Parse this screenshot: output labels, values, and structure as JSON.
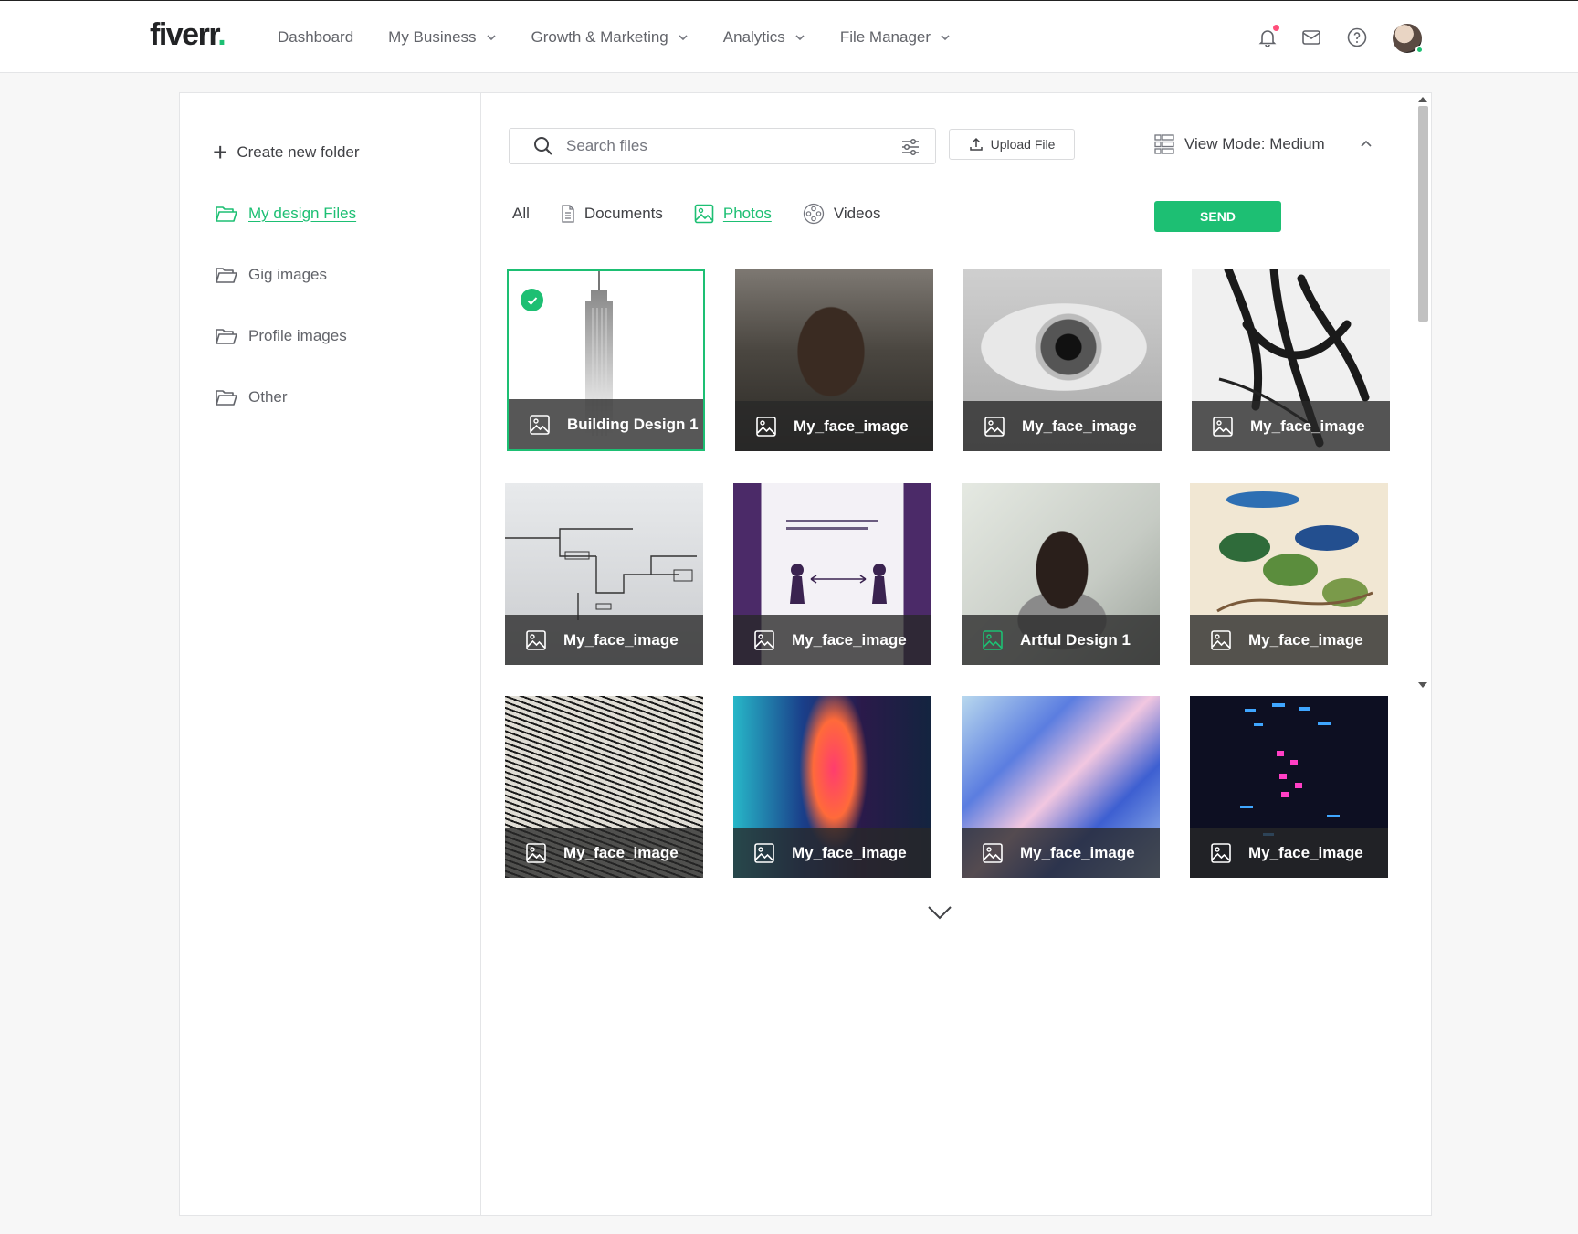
{
  "brand": {
    "logo_text": "fiverr",
    "logo_dot": "."
  },
  "nav": {
    "dashboard": "Dashboard",
    "my_business": "My Business",
    "growth_marketing": "Growth & Marketing",
    "analytics": "Analytics",
    "file_manager": "File Manager"
  },
  "sidebar": {
    "create_folder": "Create new folder",
    "folders": [
      {
        "label": "My design Files",
        "active": true
      },
      {
        "label": "Gig images",
        "active": false
      },
      {
        "label": "Profile images",
        "active": false
      },
      {
        "label": "Other",
        "active": false
      }
    ]
  },
  "toolbar": {
    "search_placeholder": "Search files",
    "upload_label": "Upload File",
    "view_mode_label": "View Mode: Medium"
  },
  "tabs": {
    "all": "All",
    "documents": "Documents",
    "photos": "Photos",
    "videos": "Videos",
    "active": "Photos"
  },
  "send_label": "SEND",
  "files": [
    {
      "name": "Building Design 1",
      "selected": true
    },
    {
      "name": "My_face_image",
      "selected": false
    },
    {
      "name": "My_face_image",
      "selected": false
    },
    {
      "name": "My_face_image",
      "selected": false
    },
    {
      "name": "My_face_image",
      "selected": false
    },
    {
      "name": "My_face_image",
      "selected": false
    },
    {
      "name": "Artful Design 1",
      "selected": false
    },
    {
      "name": "My_face_image",
      "selected": false
    },
    {
      "name": "My_face_image",
      "selected": false
    },
    {
      "name": "My_face_image",
      "selected": false
    },
    {
      "name": "My_face_image",
      "selected": false
    },
    {
      "name": "My_face_image",
      "selected": false
    }
  ],
  "colors": {
    "accent": "#1dbf73",
    "notification": "#ff4e7a"
  }
}
